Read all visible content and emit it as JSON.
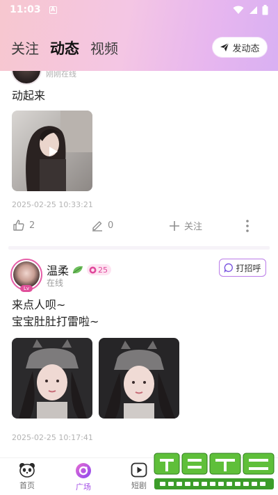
{
  "status_bar": {
    "time": "11:03",
    "notification_glyph": "A"
  },
  "header": {
    "tabs": [
      {
        "label": "关注",
        "active": false
      },
      {
        "label": "动态",
        "active": true
      },
      {
        "label": "视频",
        "active": false
      }
    ],
    "post_button_label": "发动态"
  },
  "feed": {
    "post1": {
      "status": "刚刚在线",
      "text": "动起来",
      "timestamp": "2025-02-25 10:33:21",
      "likes": "2",
      "comments": "0",
      "follow_label": "关注"
    },
    "post2": {
      "username": "温柔",
      "level": "25",
      "avatar_level": "Lv",
      "status": "在线",
      "greet_label": "打招呼",
      "text_line1": "来点人呗~",
      "text_line2": "宝宝肚肚打雷啦~",
      "timestamp": "2025-02-25 10:17:41"
    }
  },
  "bottom_nav": {
    "items": [
      {
        "label": "首页",
        "active": false
      },
      {
        "label": "广场",
        "active": true
      },
      {
        "label": "短剧",
        "active": false
      }
    ]
  },
  "colors": {
    "accent": "#a24de6",
    "pink": "#e0479b",
    "header_gradient_start": "#f7c7cf",
    "header_gradient_end": "#d9b0f2"
  }
}
